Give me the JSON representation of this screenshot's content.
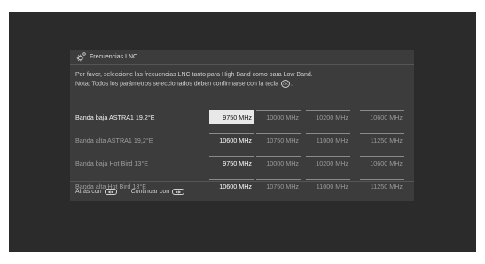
{
  "dialog": {
    "title": "Frecuencias LNC",
    "message_line1": "Por favor, seleccione las frecuencias LNC tanto para High Band como para Low Band.",
    "message_line2": "Nota: Todos los parámetros seleccionados deben confirmarse con la tecla",
    "message_line2_end": ".",
    "ok_key_glyph": "OK"
  },
  "rows": [
    {
      "label": "Banda baja ASTRA1 19,2°E",
      "options": [
        "9750 MHz",
        "10000 MHz",
        "10200 MHz",
        "10600 MHz"
      ],
      "selected_index": 0,
      "focused": true
    },
    {
      "label": "Banda alta ASTRA1 19,2°E",
      "options": [
        "10600 MHz",
        "10750 MHz",
        "11000 MHz",
        "11250 MHz"
      ],
      "selected_index": 0,
      "focused": false
    },
    {
      "label": "Banda baja Hot Bird 13°E",
      "options": [
        "9750 MHz",
        "10000 MHz",
        "10200 MHz",
        "10600 MHz"
      ],
      "selected_index": 0,
      "focused": false
    },
    {
      "label": "Banda alta Hot Bird 13°E",
      "options": [
        "10600 MHz",
        "10750 MHz",
        "11000 MHz",
        "11250 MHz"
      ],
      "selected_index": 0,
      "focused": false
    }
  ],
  "footer": {
    "back_label": "Atrás con",
    "continue_label": "Continuar con",
    "back_key_glyph": "◀◀",
    "continue_key_glyph": "▶▶"
  }
}
